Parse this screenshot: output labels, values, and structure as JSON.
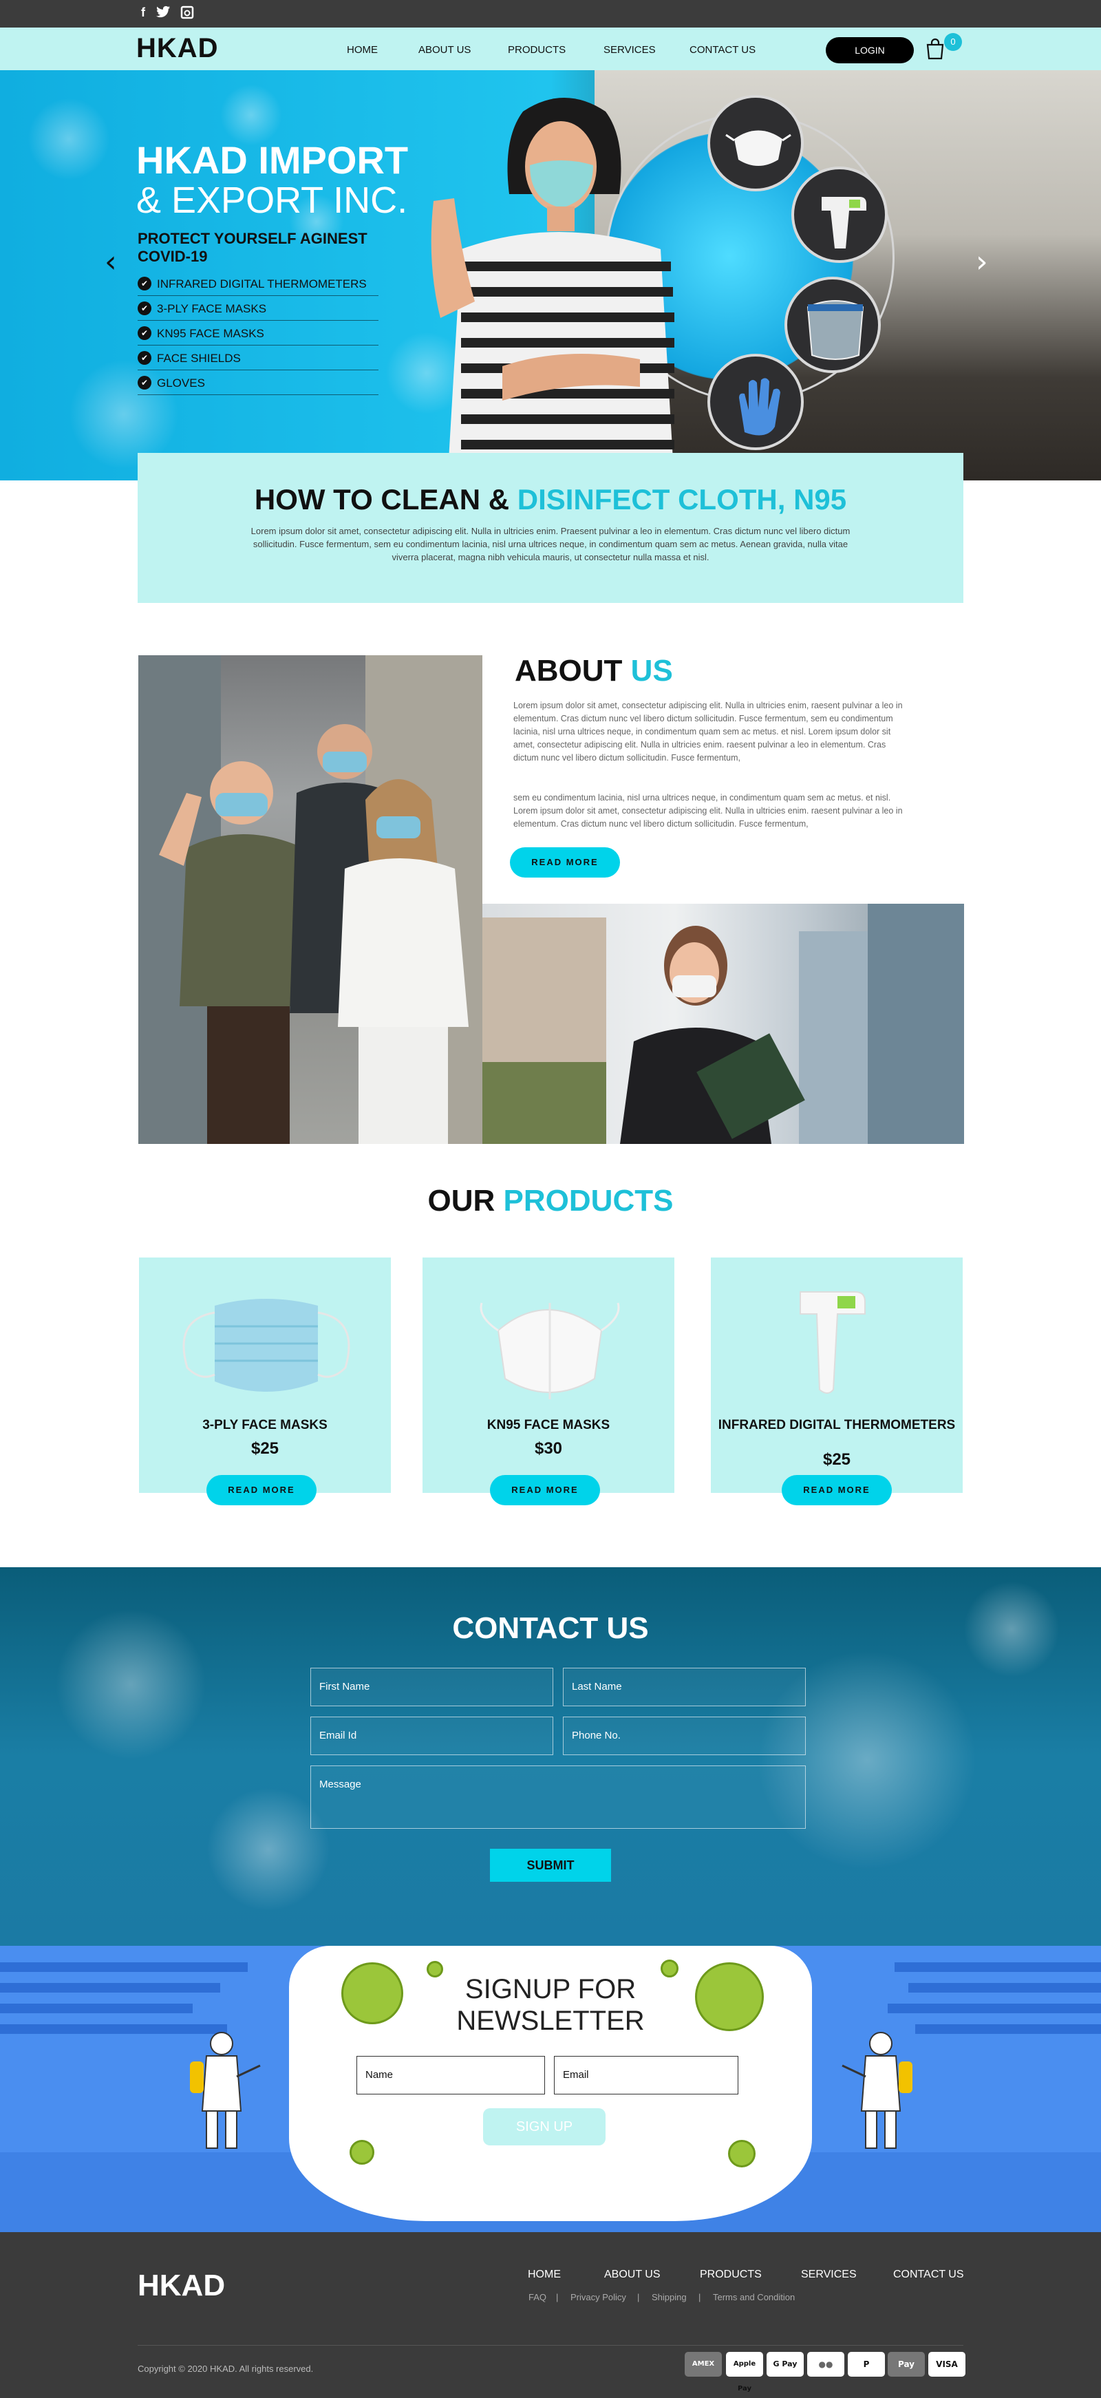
{
  "header": {
    "social": [
      "f",
      "t",
      "ig"
    ],
    "logo": "HKAD",
    "nav": [
      "HOME",
      "ABOUT US",
      "PRODUCTS",
      "SERVICES",
      "CONTACT US"
    ],
    "login": "LOGIN",
    "cart_count": "0"
  },
  "hero": {
    "title_line1": "HKAD IMPORT",
    "title_line2": "& EXPORT INC.",
    "subtitle": "PROTECT YOURSELF AGINEST COVID-19",
    "bullets": [
      "INFRARED DIGITAL THERMOMETERS",
      "3-PLY FACE MASKS",
      "KN95 FACE MASKS",
      "FACE SHIELDS",
      "GLOVES"
    ],
    "prev": "‹",
    "next": "›"
  },
  "clean": {
    "title_dark": "HOW TO CLEAN &",
    "title_accent": "DISINFECT CLOTH, N95",
    "text": "Lorem ipsum dolor sit amet, consectetur adipiscing elit. Nulla in ultricies enim. Praesent pulvinar a leo in elementum. Cras dictum nunc vel libero dictum sollicitudin. Fusce fermentum, sem eu condimentum lacinia, nisl urna ultrices neque, in condimentum quam sem ac metus. Aenean gravida, nulla vitae viverra placerat, magna nibh vehicula mauris, ut consectetur nulla massa et nisl."
  },
  "about": {
    "title_dark": "ABOUT",
    "title_accent": "US",
    "para1": "Lorem ipsum dolor sit amet, consectetur adipiscing elit. Nulla in ultricies enim, raesent pulvinar a leo in elementum. Cras dictum nunc vel libero dictum sollicitudin. Fusce fermentum, sem eu condimentum lacinia, nisl urna ultrices neque, in condimentum quam sem ac metus. et nisl. Lorem ipsum dolor sit amet, consectetur adipiscing elit. Nulla in ultricies enim. raesent pulvinar a leo in elementum. Cras dictum nunc vel libero dictum sollicitudin. Fusce fermentum,",
    "para2": "sem eu condimentum lacinia, nisl urna ultrices neque, in condimentum quam sem ac metus. et nisl. Lorem ipsum dolor sit amet, consectetur adipiscing elit. Nulla in ultricies enim. raesent pulvinar a leo in elementum. Cras dictum nunc vel libero dictum sollicitudin. Fusce fermentum,",
    "button": "READ MORE"
  },
  "products": {
    "title_dark": "OUR",
    "title_accent": "PRODUCTS",
    "items": [
      {
        "name": "3-PLY FACE MASKS",
        "price": "$25",
        "button": "READ MORE"
      },
      {
        "name": "KN95 FACE MASKS",
        "price": "$30",
        "button": "READ MORE"
      },
      {
        "name": "INFRARED DIGITAL THERMOMETERS",
        "price": "$25",
        "button": "READ MORE"
      }
    ]
  },
  "contact": {
    "title": "CONTACT US",
    "first_name": "First Name",
    "last_name": "Last Name",
    "email": "Email Id",
    "phone": "Phone No.",
    "message": "Message",
    "submit": "SUBMIT"
  },
  "newsletter": {
    "title_line1": "SIGNUP FOR",
    "title_line2": "NEWSLETTER",
    "name": "Name",
    "email": "Email",
    "button": "SIGN UP"
  },
  "footer": {
    "logo": "HKAD",
    "nav": [
      "HOME",
      "ABOUT US",
      "PRODUCTS",
      "SERVICES",
      "CONTACT US"
    ],
    "links": [
      "FAQ",
      "|",
      "Privacy Policy",
      "|",
      "Shipping",
      "|",
      "Terms and Condition"
    ],
    "copyright": "Copyright © 2020 HKAD. All rights reserved.",
    "payments": [
      "AMEX",
      "Apple Pay",
      "G Pay",
      "●●",
      "P",
      "Pay",
      "VISA"
    ]
  },
  "colors": {
    "accent": "#1ec0d8",
    "mint": "#bff3f1",
    "button": "#00d3ea",
    "footer": "#3b3b3b"
  }
}
